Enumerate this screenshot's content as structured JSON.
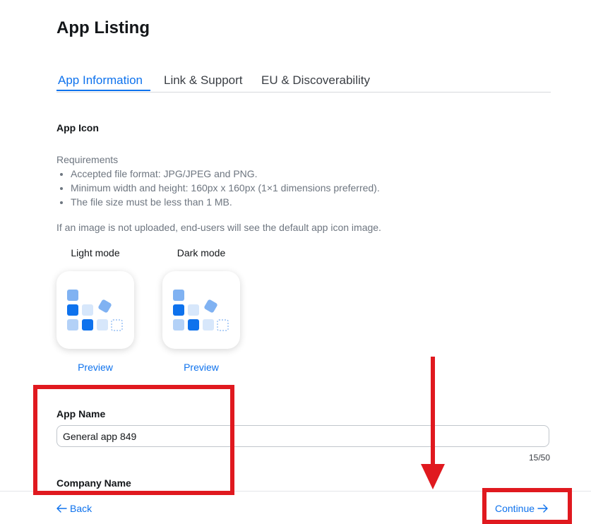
{
  "page": {
    "title": "App Listing"
  },
  "tabs": [
    {
      "label": "App Information",
      "active": true
    },
    {
      "label": "Link & Support",
      "active": false
    },
    {
      "label": "EU & Discoverability",
      "active": false
    }
  ],
  "app_icon": {
    "label": "App Icon",
    "requirements_title": "Requirements",
    "requirements": [
      "Accepted file format: JPG/JPEG and PNG.",
      "Minimum width and height: 160px x 160px (1×1 dimensions preferred).",
      "The file size must be less than 1 MB."
    ],
    "note": "If an image is not uploaded, end-users will see the default app icon image.",
    "modes": [
      {
        "label": "Light mode",
        "preview_label": "Preview",
        "icon": "default-app-grid-icon"
      },
      {
        "label": "Dark mode",
        "preview_label": "Preview",
        "icon": "default-app-grid-icon"
      }
    ]
  },
  "app_name": {
    "label": "App Name",
    "value": "General app 849",
    "placeholder": "",
    "counter": "15/50"
  },
  "company_name": {
    "label": "Company Name"
  },
  "footer": {
    "back_label": "Back",
    "continue_label": "Continue"
  },
  "colors": {
    "accent": "#0e72ed",
    "annotation": "#e0191f",
    "icon_light": "#b3d1f7",
    "icon_mid": "#80b2f2",
    "icon_dark": "#0e72ed",
    "icon_pale": "#d7e7fb"
  }
}
